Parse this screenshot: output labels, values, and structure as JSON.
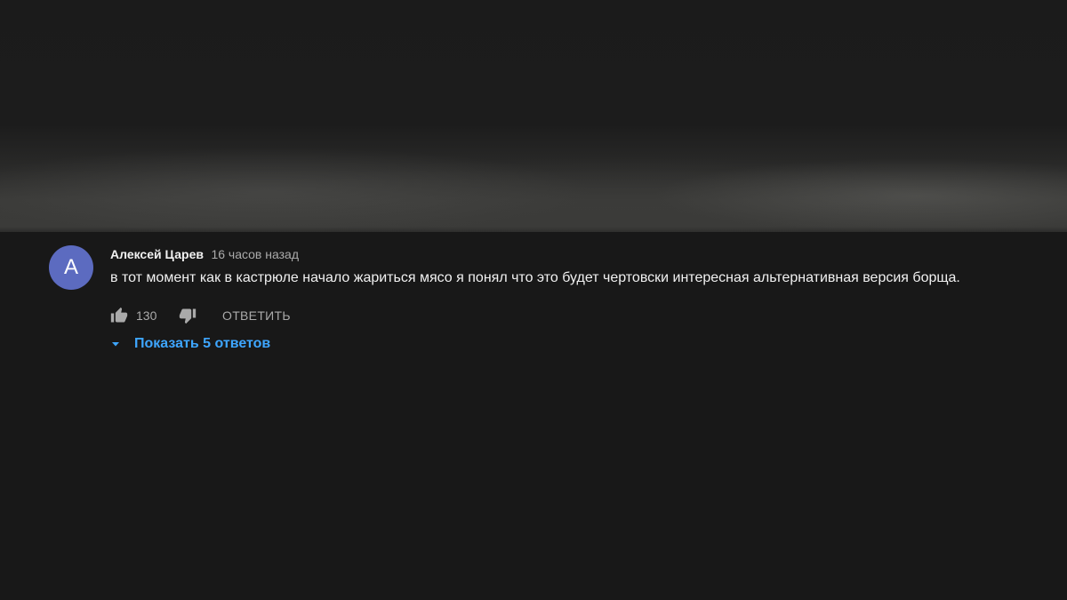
{
  "comment": {
    "avatar_letter": "A",
    "avatar_color": "#5c6bc0",
    "author": "Алексей Царев",
    "time": "16 часов назад",
    "text": "в тот момент как в кастрюле начало жариться мясо я понял что это будет чертовски интересная альтернативная версия борща.",
    "like_count": "130",
    "like_icon": "thumb-up-icon",
    "dislike_icon": "thumb-down-icon",
    "reply_label": "ОТВЕТИТЬ",
    "show_replies_label": "Показать 5 ответов",
    "show_replies_icon": "caret-down-icon",
    "accent_color": "#3ea6ff"
  }
}
